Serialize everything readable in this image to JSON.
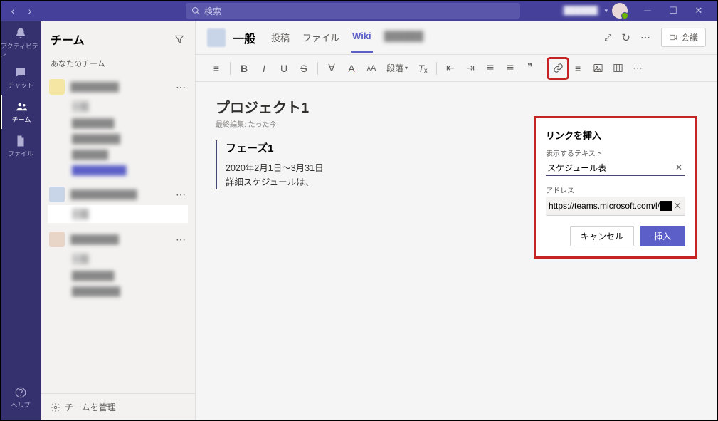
{
  "search": {
    "placeholder": "検索"
  },
  "rail": {
    "activity": "アクティビティ",
    "chat": "チャット",
    "teams": "チーム",
    "files": "ファイル",
    "help": "ヘルプ"
  },
  "sidebar": {
    "title": "チーム",
    "section": "あなたのチーム",
    "manage": "チームを管理",
    "teams": [
      {
        "name": "████████",
        "channels": [
          "一般",
          "███████",
          "████████",
          "██████",
          "█████████"
        ]
      },
      {
        "name": "███████████",
        "channels": [
          "一般"
        ]
      },
      {
        "name": "████████",
        "channels": [
          "一般",
          "███████",
          "████████"
        ]
      }
    ]
  },
  "channel": {
    "name": "一般",
    "tabs": [
      "投稿",
      "ファイル",
      "Wiki"
    ],
    "tabExtra": "██████",
    "meet": "会議"
  },
  "toolbar": {
    "paragraph": "段落"
  },
  "wiki": {
    "title": "プロジェクト1",
    "subtitle": "最終編集: たった今",
    "sectionTitle": "フェーズ1",
    "line1": "2020年2月1日～3月31日",
    "line2": "詳細スケジュールは、"
  },
  "popup": {
    "title": "リンクを挿入",
    "textLabel": "表示するテキスト",
    "textValue": "スケジュール表",
    "addrLabel": "アドレス",
    "addrValue": "https://teams.microsoft.com/l/███",
    "cancel": "キャンセル",
    "insert": "挿入"
  }
}
